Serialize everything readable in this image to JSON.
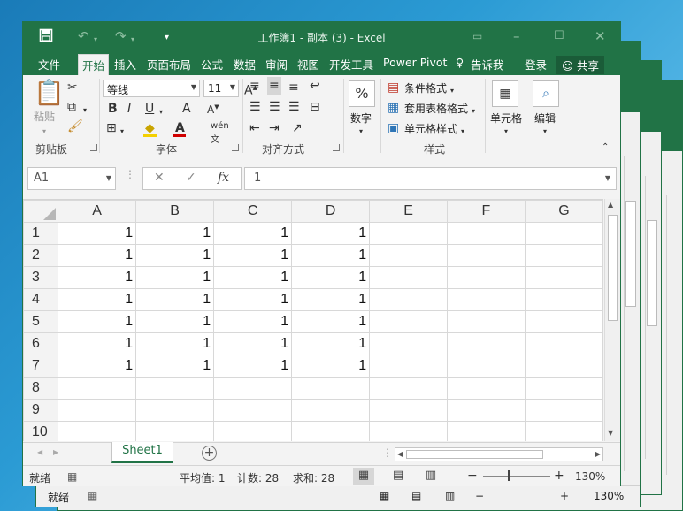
{
  "window": {
    "title": "工作簿1 - 副本 (3)  -  Excel"
  },
  "titlebar_icons": [
    "save-icon",
    "undo-icon",
    "redo-icon",
    "customize-qat-icon",
    "ribbon-display-icon",
    "minimize-icon",
    "maximize-icon",
    "close-icon"
  ],
  "menu": {
    "tabs": [
      "文件",
      "开始",
      "插入",
      "页面布局",
      "公式",
      "数据",
      "审阅",
      "视图",
      "开发工具",
      "Power Pivot"
    ],
    "active": "开始",
    "tell_me": "告诉我",
    "login": "登录",
    "share": "共享"
  },
  "ribbon": {
    "clipboard": {
      "paste": "粘贴",
      "label": "剪贴板"
    },
    "font": {
      "name": "等线",
      "size": "11",
      "label": "字体"
    },
    "alignment": {
      "label": "对齐方式"
    },
    "number": {
      "button": "数字"
    },
    "styles": {
      "conditional": "条件格式",
      "table": "套用表格格式",
      "cell": "单元格样式",
      "label": "样式"
    },
    "cells": {
      "button": "单元格"
    },
    "editing": {
      "button": "编辑"
    }
  },
  "formula_bar": {
    "name_box": "A1",
    "fx": "fx",
    "value": "1"
  },
  "grid": {
    "columns": [
      "A",
      "B",
      "C",
      "D",
      "E",
      "F",
      "G"
    ],
    "rows": [
      {
        "num": "1",
        "cells": [
          "1",
          "1",
          "1",
          "1",
          "",
          "",
          ""
        ]
      },
      {
        "num": "2",
        "cells": [
          "1",
          "1",
          "1",
          "1",
          "",
          "",
          ""
        ]
      },
      {
        "num": "3",
        "cells": [
          "1",
          "1",
          "1",
          "1",
          "",
          "",
          ""
        ]
      },
      {
        "num": "4",
        "cells": [
          "1",
          "1",
          "1",
          "1",
          "",
          "",
          ""
        ]
      },
      {
        "num": "5",
        "cells": [
          "1",
          "1",
          "1",
          "1",
          "",
          "",
          ""
        ]
      },
      {
        "num": "6",
        "cells": [
          "1",
          "1",
          "1",
          "1",
          "",
          "",
          ""
        ]
      },
      {
        "num": "7",
        "cells": [
          "1",
          "1",
          "1",
          "1",
          "",
          "",
          ""
        ]
      },
      {
        "num": "8",
        "cells": [
          "",
          "",
          "",
          "",
          "",
          "",
          ""
        ]
      },
      {
        "num": "9",
        "cells": [
          "",
          "",
          "",
          "",
          "",
          "",
          ""
        ]
      },
      {
        "num": "10",
        "cells": [
          "",
          "",
          "",
          "",
          "",
          "",
          ""
        ]
      }
    ]
  },
  "sheet_tabs": [
    "Sheet1"
  ],
  "status": {
    "ready": "就绪",
    "average": "平均值: 1",
    "count": "计数: 28",
    "sum": "求和: 28",
    "zoom": "130%"
  },
  "background_windows": [
    {
      "status": "就绪",
      "zoom": "130%"
    }
  ],
  "colors": {
    "excel_green": "#217346",
    "ribbon_bg": "#f3f3f3"
  }
}
